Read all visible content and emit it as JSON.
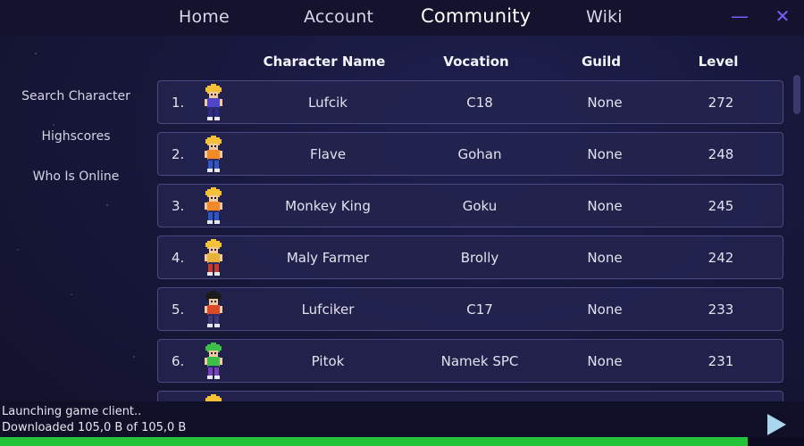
{
  "nav": {
    "home": "Home",
    "account": "Account",
    "community": "Community",
    "wiki": "Wiki",
    "minimize": "—",
    "close": "✕"
  },
  "sidebar": {
    "items": [
      {
        "label": "Search Character"
      },
      {
        "label": "Highscores"
      },
      {
        "label": "Who Is Online"
      }
    ]
  },
  "table": {
    "headers": {
      "name": "Character Name",
      "vocation": "Vocation",
      "guild": "Guild",
      "level": "Level"
    },
    "rows": [
      {
        "rank": "1.",
        "name": "Lufcik",
        "vocation": "C18",
        "guild": "None",
        "level": "272",
        "hair": "#f3c23a",
        "body": "#4f47c7",
        "legs": "#2b2b8a"
      },
      {
        "rank": "2.",
        "name": "Flave",
        "vocation": "Gohan",
        "guild": "None",
        "level": "248",
        "hair": "#f3c23a",
        "body": "#f08a2a",
        "legs": "#2f55c9"
      },
      {
        "rank": "3.",
        "name": "Monkey King",
        "vocation": "Goku",
        "guild": "None",
        "level": "245",
        "hair": "#f3c23a",
        "body": "#f08a2a",
        "legs": "#2f55c9"
      },
      {
        "rank": "4.",
        "name": "Maly Farmer",
        "vocation": "Brolly",
        "guild": "None",
        "level": "242",
        "hair": "#f3c23a",
        "body": "#e7b23a",
        "legs": "#c73a2a"
      },
      {
        "rank": "5.",
        "name": "Lufciker",
        "vocation": "C17",
        "guild": "None",
        "level": "233",
        "hair": "#1b1b1b",
        "body": "#d94a2a",
        "legs": "#3b3b7a"
      },
      {
        "rank": "6.",
        "name": "Pitok",
        "vocation": "Namek SPC",
        "guild": "None",
        "level": "231",
        "hair": "#3fbf4a",
        "body": "#3fbf4a",
        "legs": "#7a3fbf"
      },
      {
        "rank": "",
        "name": "",
        "vocation": "",
        "guild": "",
        "level": "",
        "hair": "#f3c23a",
        "body": "#f08a2a",
        "legs": "#2f55c9"
      }
    ]
  },
  "footer": {
    "status": "Launching game client..",
    "download": "Downloaded 105,0 B of 105,0 B",
    "progress_percent": 93
  },
  "colors": {
    "accent": "#7b5cff",
    "progress": "#22c43a",
    "play": "#a9d6ec"
  },
  "icons": {
    "minimize": "minimize-icon",
    "close": "close-icon",
    "play": "play-icon"
  }
}
